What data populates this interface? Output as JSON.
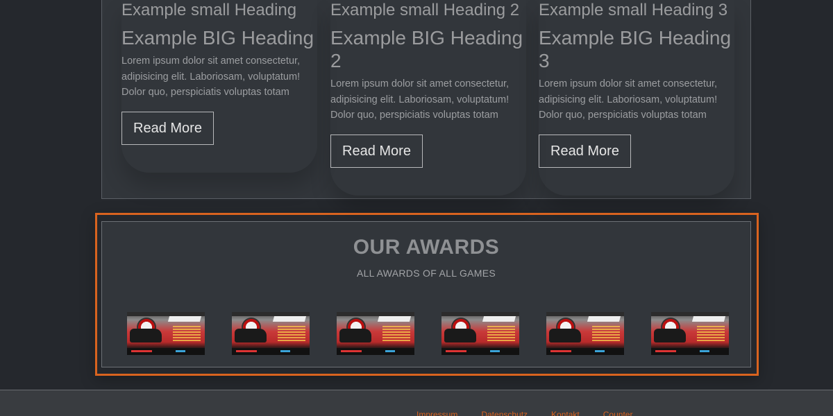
{
  "cards": [
    {
      "small_heading": "Example small Heading",
      "big_heading": "Example BIG Heading",
      "text": "Lorem ipsum dolor sit amet consectetur, adipisicing elit. Laboriosam, voluptatum! Dolor quo, perspiciatis voluptas totam",
      "button_label": "Read More"
    },
    {
      "small_heading": "Example small Heading 2",
      "big_heading": "Example BIG Heading 2",
      "text": "Lorem ipsum dolor sit amet consectetur, adipisicing elit. Laboriosam, voluptatum! Dolor quo, perspiciatis voluptas totam",
      "button_label": "Read More"
    },
    {
      "small_heading": "Example small Heading 3",
      "big_heading": "Example BIG Heading 3",
      "text": "Lorem ipsum dolor sit amet consectetur, adipisicing elit. Laboriosam, voluptatum! Dolor quo, perspiciatis voluptas totam",
      "button_label": "Read More"
    }
  ],
  "awards": {
    "title": "OUR AWARDS",
    "subtitle": "ALL AWARDS OF ALL GAMES",
    "count": 6
  },
  "footer": {
    "links": [
      "Impressum",
      "Datenschutz",
      "Kontakt",
      "Counter"
    ]
  },
  "colors": {
    "accent": "#d9631f",
    "panel": "#32363b",
    "background": "#25282d"
  }
}
